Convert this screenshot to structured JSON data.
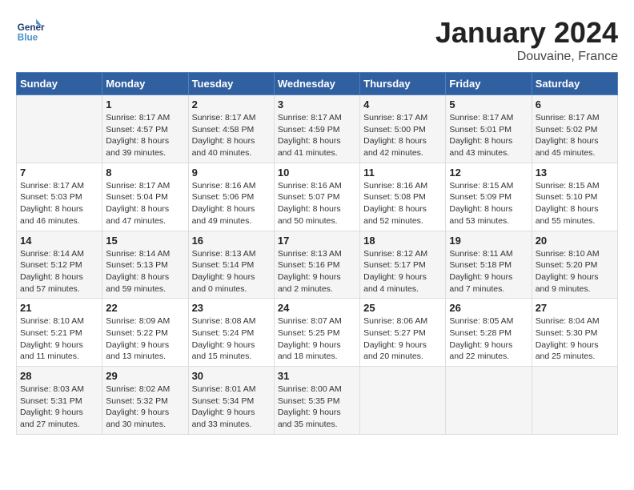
{
  "header": {
    "logo_line1": "General",
    "logo_line2": "Blue",
    "month": "January 2024",
    "location": "Douvaine, France"
  },
  "weekdays": [
    "Sunday",
    "Monday",
    "Tuesday",
    "Wednesday",
    "Thursday",
    "Friday",
    "Saturday"
  ],
  "weeks": [
    [
      {
        "day": "",
        "info": ""
      },
      {
        "day": "1",
        "info": "Sunrise: 8:17 AM\nSunset: 4:57 PM\nDaylight: 8 hours\nand 39 minutes."
      },
      {
        "day": "2",
        "info": "Sunrise: 8:17 AM\nSunset: 4:58 PM\nDaylight: 8 hours\nand 40 minutes."
      },
      {
        "day": "3",
        "info": "Sunrise: 8:17 AM\nSunset: 4:59 PM\nDaylight: 8 hours\nand 41 minutes."
      },
      {
        "day": "4",
        "info": "Sunrise: 8:17 AM\nSunset: 5:00 PM\nDaylight: 8 hours\nand 42 minutes."
      },
      {
        "day": "5",
        "info": "Sunrise: 8:17 AM\nSunset: 5:01 PM\nDaylight: 8 hours\nand 43 minutes."
      },
      {
        "day": "6",
        "info": "Sunrise: 8:17 AM\nSunset: 5:02 PM\nDaylight: 8 hours\nand 45 minutes."
      }
    ],
    [
      {
        "day": "7",
        "info": "Sunrise: 8:17 AM\nSunset: 5:03 PM\nDaylight: 8 hours\nand 46 minutes."
      },
      {
        "day": "8",
        "info": "Sunrise: 8:17 AM\nSunset: 5:04 PM\nDaylight: 8 hours\nand 47 minutes."
      },
      {
        "day": "9",
        "info": "Sunrise: 8:16 AM\nSunset: 5:06 PM\nDaylight: 8 hours\nand 49 minutes."
      },
      {
        "day": "10",
        "info": "Sunrise: 8:16 AM\nSunset: 5:07 PM\nDaylight: 8 hours\nand 50 minutes."
      },
      {
        "day": "11",
        "info": "Sunrise: 8:16 AM\nSunset: 5:08 PM\nDaylight: 8 hours\nand 52 minutes."
      },
      {
        "day": "12",
        "info": "Sunrise: 8:15 AM\nSunset: 5:09 PM\nDaylight: 8 hours\nand 53 minutes."
      },
      {
        "day": "13",
        "info": "Sunrise: 8:15 AM\nSunset: 5:10 PM\nDaylight: 8 hours\nand 55 minutes."
      }
    ],
    [
      {
        "day": "14",
        "info": "Sunrise: 8:14 AM\nSunset: 5:12 PM\nDaylight: 8 hours\nand 57 minutes."
      },
      {
        "day": "15",
        "info": "Sunrise: 8:14 AM\nSunset: 5:13 PM\nDaylight: 8 hours\nand 59 minutes."
      },
      {
        "day": "16",
        "info": "Sunrise: 8:13 AM\nSunset: 5:14 PM\nDaylight: 9 hours\nand 0 minutes."
      },
      {
        "day": "17",
        "info": "Sunrise: 8:13 AM\nSunset: 5:16 PM\nDaylight: 9 hours\nand 2 minutes."
      },
      {
        "day": "18",
        "info": "Sunrise: 8:12 AM\nSunset: 5:17 PM\nDaylight: 9 hours\nand 4 minutes."
      },
      {
        "day": "19",
        "info": "Sunrise: 8:11 AM\nSunset: 5:18 PM\nDaylight: 9 hours\nand 7 minutes."
      },
      {
        "day": "20",
        "info": "Sunrise: 8:10 AM\nSunset: 5:20 PM\nDaylight: 9 hours\nand 9 minutes."
      }
    ],
    [
      {
        "day": "21",
        "info": "Sunrise: 8:10 AM\nSunset: 5:21 PM\nDaylight: 9 hours\nand 11 minutes."
      },
      {
        "day": "22",
        "info": "Sunrise: 8:09 AM\nSunset: 5:22 PM\nDaylight: 9 hours\nand 13 minutes."
      },
      {
        "day": "23",
        "info": "Sunrise: 8:08 AM\nSunset: 5:24 PM\nDaylight: 9 hours\nand 15 minutes."
      },
      {
        "day": "24",
        "info": "Sunrise: 8:07 AM\nSunset: 5:25 PM\nDaylight: 9 hours\nand 18 minutes."
      },
      {
        "day": "25",
        "info": "Sunrise: 8:06 AM\nSunset: 5:27 PM\nDaylight: 9 hours\nand 20 minutes."
      },
      {
        "day": "26",
        "info": "Sunrise: 8:05 AM\nSunset: 5:28 PM\nDaylight: 9 hours\nand 22 minutes."
      },
      {
        "day": "27",
        "info": "Sunrise: 8:04 AM\nSunset: 5:30 PM\nDaylight: 9 hours\nand 25 minutes."
      }
    ],
    [
      {
        "day": "28",
        "info": "Sunrise: 8:03 AM\nSunset: 5:31 PM\nDaylight: 9 hours\nand 27 minutes."
      },
      {
        "day": "29",
        "info": "Sunrise: 8:02 AM\nSunset: 5:32 PM\nDaylight: 9 hours\nand 30 minutes."
      },
      {
        "day": "30",
        "info": "Sunrise: 8:01 AM\nSunset: 5:34 PM\nDaylight: 9 hours\nand 33 minutes."
      },
      {
        "day": "31",
        "info": "Sunrise: 8:00 AM\nSunset: 5:35 PM\nDaylight: 9 hours\nand 35 minutes."
      },
      {
        "day": "",
        "info": ""
      },
      {
        "day": "",
        "info": ""
      },
      {
        "day": "",
        "info": ""
      }
    ]
  ]
}
